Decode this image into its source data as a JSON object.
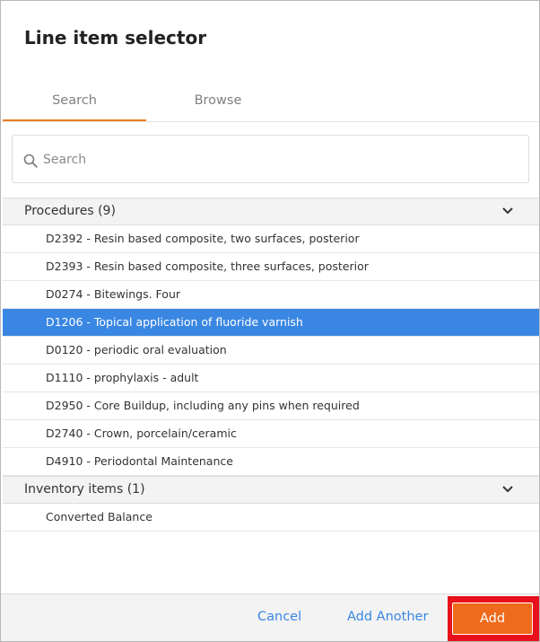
{
  "dialog": {
    "title": "Line item selector"
  },
  "tabs": [
    {
      "label": "Search",
      "active": true
    },
    {
      "label": "Browse",
      "active": false
    }
  ],
  "search": {
    "placeholder": "Search",
    "value": ""
  },
  "groups": [
    {
      "label": "Procedures (9)",
      "expanded": true,
      "items": [
        {
          "label": "D2392 - Resin based composite, two surfaces, posterior",
          "selected": false
        },
        {
          "label": "D2393 - Resin based composite, three surfaces, posterior",
          "selected": false
        },
        {
          "label": "D0274 - Bitewings. Four",
          "selected": false
        },
        {
          "label": "D1206 - Topical application of fluoride varnish",
          "selected": true
        },
        {
          "label": "D0120 - periodic oral evaluation",
          "selected": false
        },
        {
          "label": "D1110 - prophylaxis - adult",
          "selected": false
        },
        {
          "label": "D2950 - Core Buildup, including any pins when required",
          "selected": false
        },
        {
          "label": "D2740 - Crown, porcelain/ceramic",
          "selected": false
        },
        {
          "label": "D4910 - Periodontal Maintenance",
          "selected": false
        }
      ]
    },
    {
      "label": "Inventory items (1)",
      "expanded": true,
      "items": [
        {
          "label": "Converted Balance",
          "selected": false
        }
      ]
    }
  ],
  "footer": {
    "cancel_label": "Cancel",
    "add_another_label": "Add Another",
    "add_label": "Add"
  },
  "colors": {
    "accent": "#ee7b1f",
    "selection": "#3a87e3",
    "link": "#3a87e3",
    "primary_button": "#ee6a1c",
    "highlight_outline": "#e8101a"
  },
  "icons": {
    "search": "search-icon",
    "expand": "chevron-down-icon"
  }
}
